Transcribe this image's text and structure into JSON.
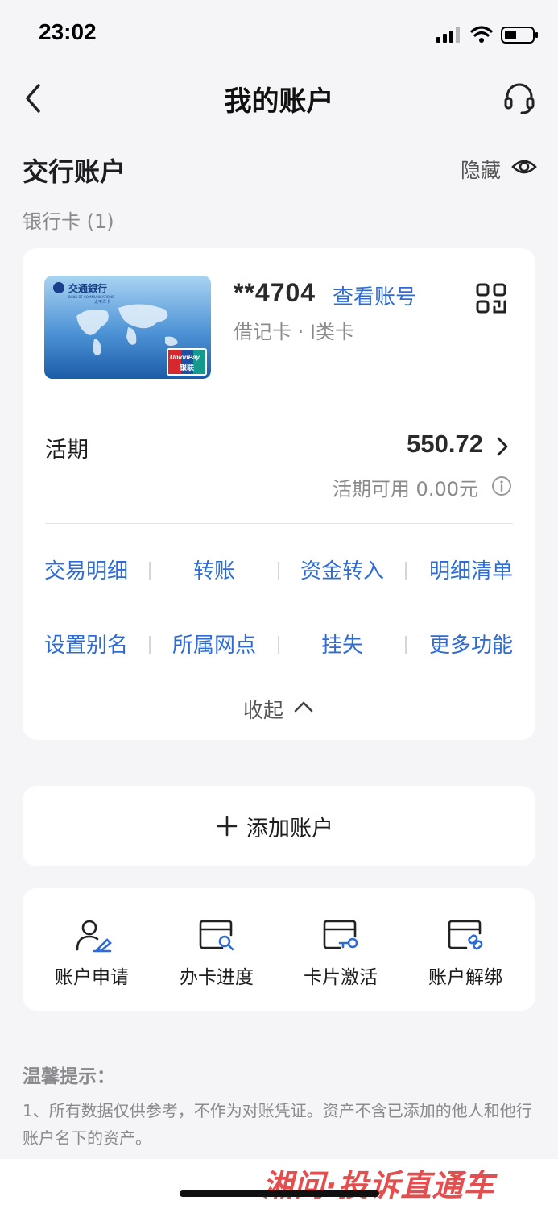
{
  "status_bar": {
    "time": "23:02"
  },
  "nav": {
    "title": "我的账户"
  },
  "section": {
    "title": "交行账户",
    "hide_label": "隐藏",
    "sub_label": "银行卡 (1)"
  },
  "bank_card": {
    "bank_name": "交通銀行",
    "bank_name_en": "BANK OF COMMUNICATIONS",
    "card_brand": "太平洋卡",
    "unionpay_en": "UnionPay",
    "unionpay_cn": "银联"
  },
  "account": {
    "masked_number": "**4704",
    "view_number_link": "查看账号",
    "card_type": "借记卡 · I类卡",
    "demand_label": "活期",
    "balance": "550.72",
    "available": "活期可用 0.00元"
  },
  "actions": {
    "row1": [
      "交易明细",
      "转账",
      "资金转入",
      "明细清单"
    ],
    "row2": [
      "设置别名",
      "所属网点",
      "挂失",
      "更多功能"
    ]
  },
  "collapse_label": "收起",
  "add_account_label": "添加账户",
  "tools": [
    {
      "label": "账户申请",
      "icon": "user-edit-icon"
    },
    {
      "label": "办卡进度",
      "icon": "card-search-icon"
    },
    {
      "label": "卡片激活",
      "icon": "card-key-icon"
    },
    {
      "label": "账户解绑",
      "icon": "card-unlink-icon"
    }
  ],
  "tips": {
    "title": "温馨提示：",
    "text": "1、所有数据仅供参考，不作为对账凭证。资产不含已添加的他人和他行账户名下的资产。"
  },
  "watermark": "湘问·投诉直通车",
  "colors": {
    "accent": "#2e6bd6",
    "background": "#f5f5f7",
    "card": "#ffffff"
  }
}
